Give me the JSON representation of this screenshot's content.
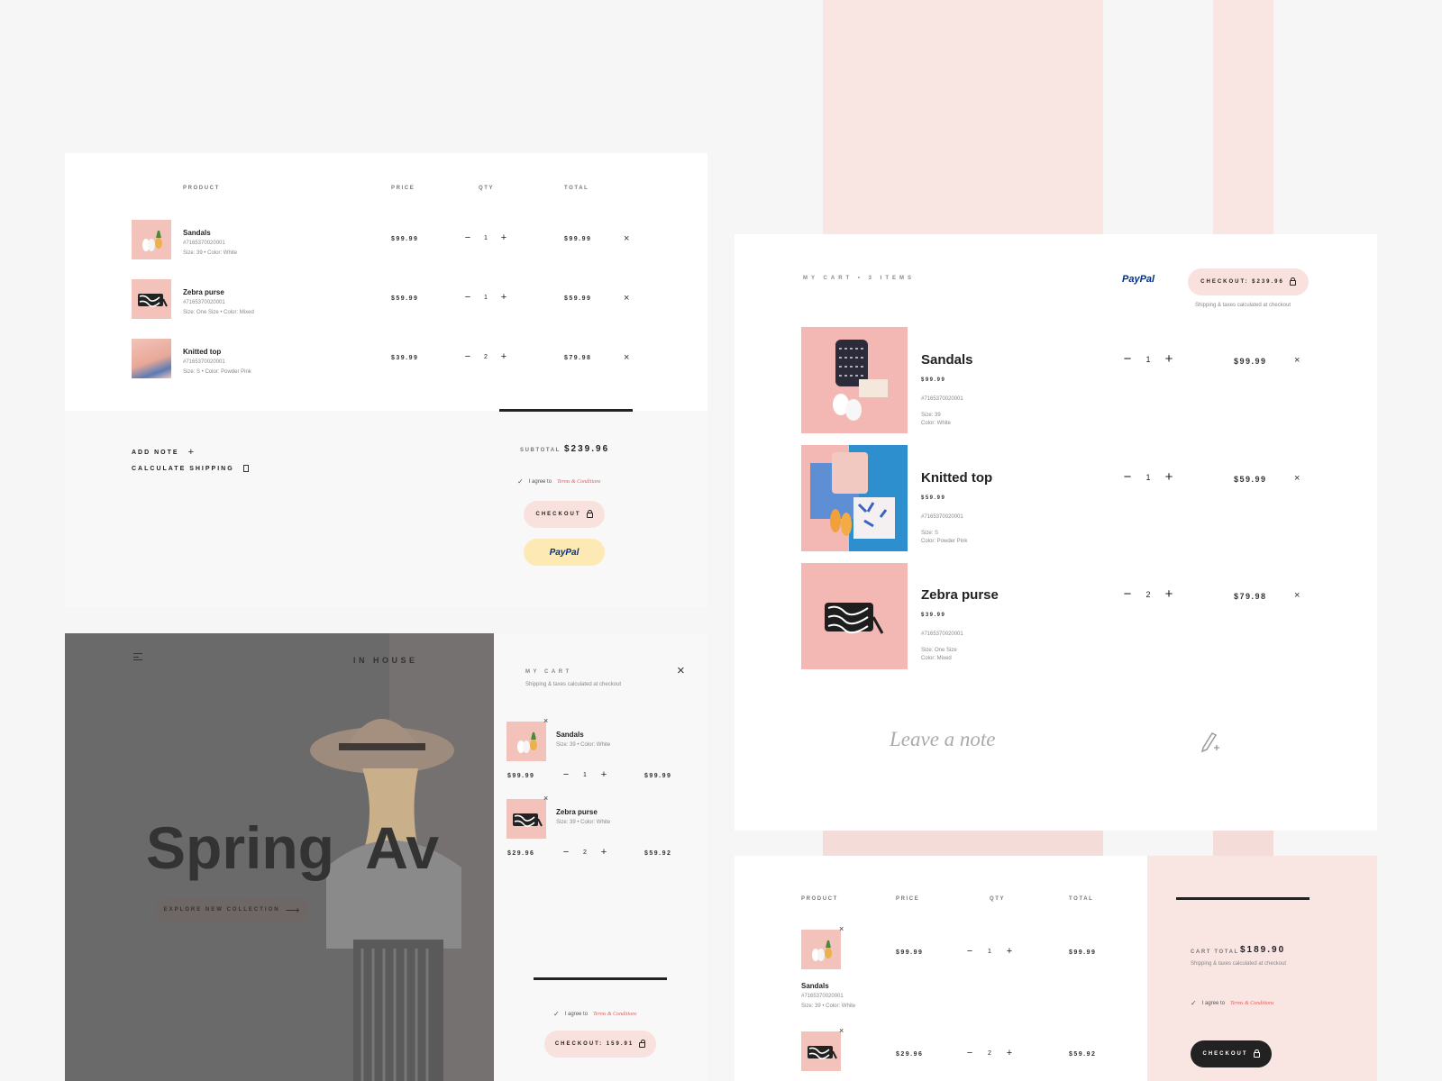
{
  "colors": {
    "pink": "#f9e6e3",
    "accent_red": "#e25b5b",
    "dark": "#222222",
    "paypal_blue": "#003087",
    "paypal_light": "#009cde",
    "yellow": "#fde9b3"
  },
  "tableCart": {
    "headers": [
      "PRODUCT",
      "PRICE",
      "QTY",
      "TOTAL"
    ],
    "items": [
      {
        "name": "Sandals",
        "sku": "#7165370020001",
        "meta": "Size: 39  •  Color: White",
        "price": "$99.99",
        "qty": "1",
        "total": "$99.99"
      },
      {
        "name": "Zebra purse",
        "sku": "#7165370020001",
        "meta": "Size: One Size  •  Color: Mixed",
        "price": "$59.99",
        "qty": "1",
        "total": "$59.99"
      },
      {
        "name": "Knitted top",
        "sku": "#7165370020001",
        "meta": "Size: S  •  Color: Powder Pink",
        "price": "$39.99",
        "qty": "2",
        "total": "$79.98"
      }
    ],
    "add_note": "ADD NOTE",
    "calculate_shipping": "CALCULATE SHIPPING",
    "subtotal_label": "SUBTOTAL",
    "subtotal_value": "$239.96",
    "agree_text": "I agree to",
    "terms_text": "Terms & Conditions",
    "checkout_label": "CHECKOUT",
    "paypal_label": "PayPal"
  },
  "bigCart": {
    "title": "MY CART  •  3 ITEMS",
    "paypal_label": "PayPal",
    "checkout_label": "CHECKOUT: $239.96",
    "shipping_note": "Shipping & taxes calculated at checkout",
    "items": [
      {
        "name": "Sandals",
        "price": "$99.99",
        "sku": "#7165370020001",
        "size": "Size: 39",
        "color": "Color: White",
        "qty": "1",
        "total": "$99.99"
      },
      {
        "name": "Knitted top",
        "price": "$59.99",
        "sku": "#7165370020001",
        "size": "Size: S",
        "color": "Color: Powder Pink",
        "qty": "1",
        "total": "$59.99"
      },
      {
        "name": "Zebra purse",
        "price": "$39.99",
        "sku": "#7165370020001",
        "size": "Size: One Size",
        "color": "Color: Mixed",
        "qty": "2",
        "total": "$79.98"
      }
    ],
    "note_placeholder": "Leave a note"
  },
  "storefront": {
    "brand": "IN HOUSE",
    "headline": "Spring  Av",
    "cta": "EXPLORE NEW COLLECTION"
  },
  "drawer": {
    "title": "MY CART",
    "shipping_note": "Shipping & taxes calculated at checkout",
    "items": [
      {
        "name": "Sandals",
        "meta": "Size: 39  •  Color: White",
        "price": "$99.99",
        "qty": "1",
        "total": "$99.99"
      },
      {
        "name": "Zebra purse",
        "meta": "Size: 39  •  Color: White",
        "price": "$29.96",
        "qty": "2",
        "total": "$59.92"
      }
    ],
    "agree_text": "I agree to",
    "terms_text": "Terms & Conditions",
    "checkout_label": "CHECKOUT: 159.91"
  },
  "cartPage": {
    "headers": [
      "PRODUCT",
      "PRICE",
      "QTY",
      "TOTAL"
    ],
    "items": [
      {
        "name": "Sandals",
        "sku": "#7165370020001",
        "meta": "Size: 39  •  Color: White",
        "price": "$99.99",
        "qty": "1",
        "total": "$99.99"
      },
      {
        "price": "$29.96",
        "qty": "2",
        "total": "$59.92"
      }
    ],
    "cart_total_label": "CART TOTAL",
    "cart_total_value": "$189.90",
    "shipping_note": "Shipping & taxes calculated at checkout",
    "agree_text": "I agree to",
    "terms_text": "Terms & Conditions",
    "checkout_label": "CHECKOUT"
  },
  "qty_minus": "−",
  "qty_plus": "+",
  "close_glyph": "×"
}
